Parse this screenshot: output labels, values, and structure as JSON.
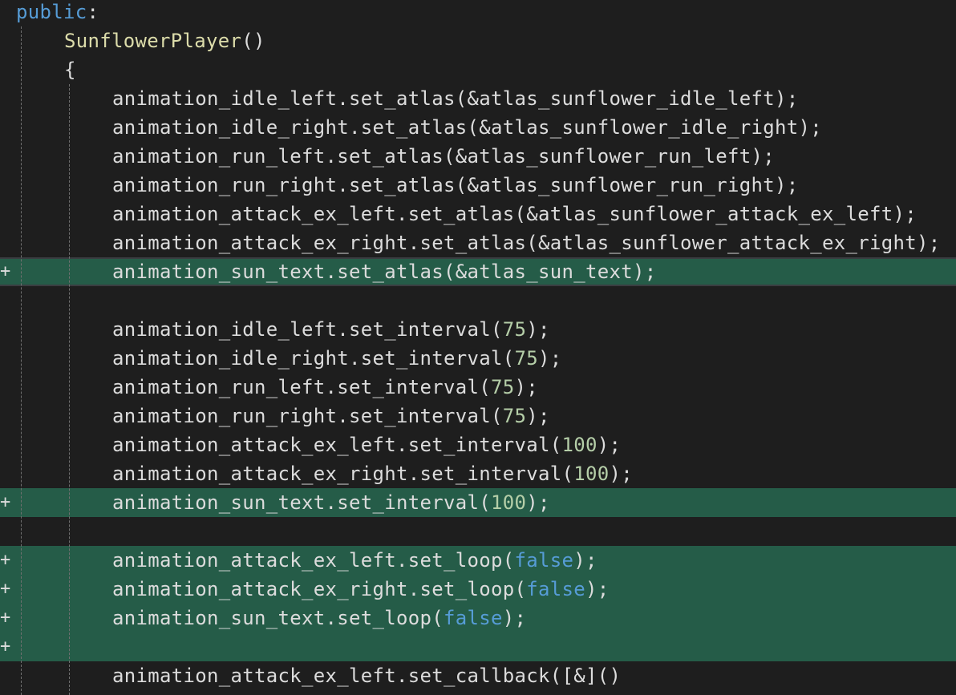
{
  "colors": {
    "background": "#1e1e1e",
    "added_line": "#255c48",
    "keyword": "#569cd6",
    "function": "#dcdcaa",
    "number": "#b5cea8",
    "identifier": "#dcdcdc"
  },
  "diff_marker": "+",
  "lines": [
    {
      "indent": 0,
      "added": false,
      "tokens": [
        {
          "t": "public",
          "c": "kw"
        },
        {
          "t": ":",
          "c": "id"
        }
      ]
    },
    {
      "indent": 1,
      "added": false,
      "tokens": [
        {
          "t": "SunflowerPlayer",
          "c": "fn"
        },
        {
          "t": "()",
          "c": "id"
        }
      ]
    },
    {
      "indent": 1,
      "added": false,
      "tokens": [
        {
          "t": "{",
          "c": "id"
        }
      ]
    },
    {
      "indent": 2,
      "added": false,
      "tokens": [
        {
          "t": "animation_idle_left.set_atlas(&atlas_sunflower_idle_left);",
          "c": "id"
        }
      ]
    },
    {
      "indent": 2,
      "added": false,
      "tokens": [
        {
          "t": "animation_idle_right.set_atlas(&atlas_sunflower_idle_right);",
          "c": "id"
        }
      ]
    },
    {
      "indent": 2,
      "added": false,
      "tokens": [
        {
          "t": "animation_run_left.set_atlas(&atlas_sunflower_run_left);",
          "c": "id"
        }
      ]
    },
    {
      "indent": 2,
      "added": false,
      "tokens": [
        {
          "t": "animation_run_right.set_atlas(&atlas_sunflower_run_right);",
          "c": "id"
        }
      ]
    },
    {
      "indent": 2,
      "added": false,
      "tokens": [
        {
          "t": "animation_attack_ex_left.set_atlas(&atlas_sunflower_attack_ex_left);",
          "c": "id"
        }
      ]
    },
    {
      "indent": 2,
      "added": false,
      "tokens": [
        {
          "t": "animation_attack_ex_right.set_atlas(&atlas_sunflower_attack_ex_right);",
          "c": "id"
        }
      ]
    },
    {
      "indent": 2,
      "added": true,
      "selected": true,
      "tokens": [
        {
          "t": "animation_sun_text.set_atlas(&atlas_sun_text);",
          "c": "id"
        }
      ]
    },
    {
      "indent": 2,
      "added": false,
      "tokens": []
    },
    {
      "indent": 2,
      "added": false,
      "tokens": [
        {
          "t": "animation_idle_left.set_interval(",
          "c": "id"
        },
        {
          "t": "75",
          "c": "num"
        },
        {
          "t": ");",
          "c": "id"
        }
      ]
    },
    {
      "indent": 2,
      "added": false,
      "tokens": [
        {
          "t": "animation_idle_right.set_interval(",
          "c": "id"
        },
        {
          "t": "75",
          "c": "num"
        },
        {
          "t": ");",
          "c": "id"
        }
      ]
    },
    {
      "indent": 2,
      "added": false,
      "tokens": [
        {
          "t": "animation_run_left.set_interval(",
          "c": "id"
        },
        {
          "t": "75",
          "c": "num"
        },
        {
          "t": ");",
          "c": "id"
        }
      ]
    },
    {
      "indent": 2,
      "added": false,
      "tokens": [
        {
          "t": "animation_run_right.set_interval(",
          "c": "id"
        },
        {
          "t": "75",
          "c": "num"
        },
        {
          "t": ");",
          "c": "id"
        }
      ]
    },
    {
      "indent": 2,
      "added": false,
      "tokens": [
        {
          "t": "animation_attack_ex_left.set_interval(",
          "c": "id"
        },
        {
          "t": "100",
          "c": "num"
        },
        {
          "t": ");",
          "c": "id"
        }
      ]
    },
    {
      "indent": 2,
      "added": false,
      "tokens": [
        {
          "t": "animation_attack_ex_right.set_interval(",
          "c": "id"
        },
        {
          "t": "100",
          "c": "num"
        },
        {
          "t": ");",
          "c": "id"
        }
      ]
    },
    {
      "indent": 2,
      "added": true,
      "tokens": [
        {
          "t": "animation_sun_text.set_interval(",
          "c": "id"
        },
        {
          "t": "100",
          "c": "num"
        },
        {
          "t": ");",
          "c": "id"
        }
      ]
    },
    {
      "indent": 2,
      "added": false,
      "tokens": []
    },
    {
      "indent": 2,
      "added": true,
      "tokens": [
        {
          "t": "animation_attack_ex_left.set_loop(",
          "c": "id"
        },
        {
          "t": "false",
          "c": "kw"
        },
        {
          "t": ");",
          "c": "id"
        }
      ]
    },
    {
      "indent": 2,
      "added": true,
      "tokens": [
        {
          "t": "animation_attack_ex_right.set_loop(",
          "c": "id"
        },
        {
          "t": "false",
          "c": "kw"
        },
        {
          "t": ");",
          "c": "id"
        }
      ]
    },
    {
      "indent": 2,
      "added": true,
      "tokens": [
        {
          "t": "animation_sun_text.set_loop(",
          "c": "id"
        },
        {
          "t": "false",
          "c": "kw"
        },
        {
          "t": ");",
          "c": "id"
        }
      ]
    },
    {
      "indent": 2,
      "added": true,
      "tokens": []
    },
    {
      "indent": 2,
      "added": false,
      "tokens": [
        {
          "t": "animation_attack_ex_left.set_callback([&]()",
          "c": "id"
        }
      ]
    }
  ]
}
